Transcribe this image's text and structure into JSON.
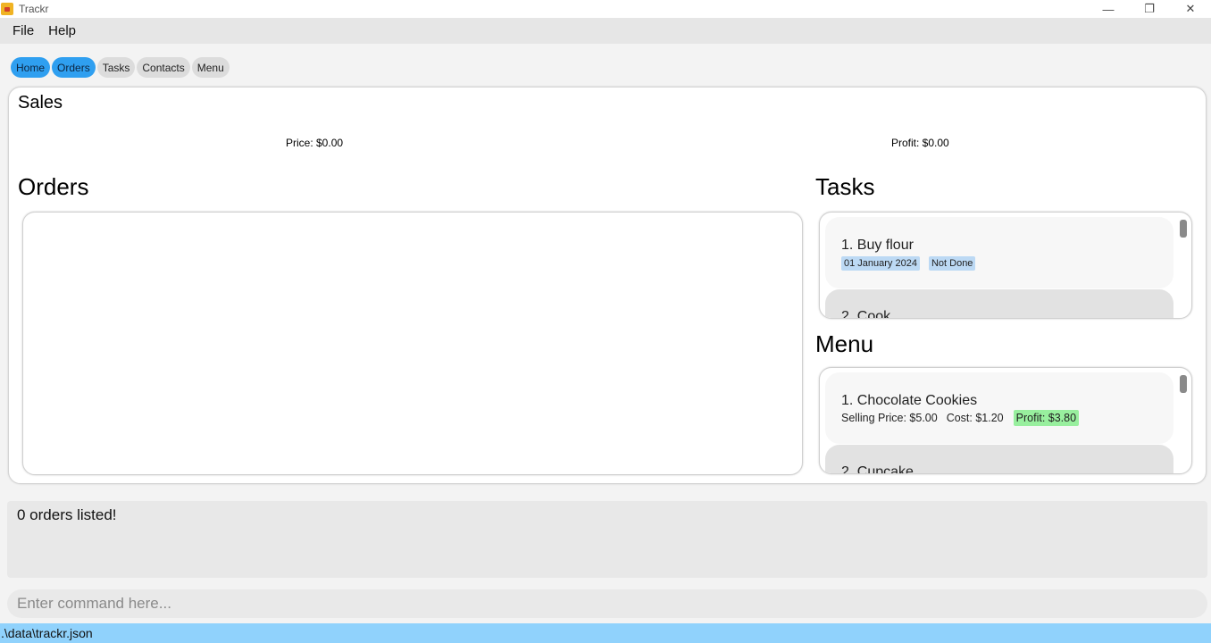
{
  "window": {
    "title": "Trackr",
    "controls": {
      "minimize": "—",
      "restore": "❐",
      "close": "✕"
    }
  },
  "menubar": {
    "items": [
      "File",
      "Help"
    ]
  },
  "tabs": [
    {
      "label": "Home",
      "active": true
    },
    {
      "label": "Orders",
      "active": true
    },
    {
      "label": "Tasks",
      "active": false
    },
    {
      "label": "Contacts",
      "active": false
    },
    {
      "label": "Menu",
      "active": false
    }
  ],
  "sales": {
    "title": "Sales",
    "price": "Price: $0.00",
    "profit": "Profit: $0.00"
  },
  "orders": {
    "title": "Orders"
  },
  "tasks": {
    "title": "Tasks",
    "items": [
      {
        "title": "1.  Buy flour",
        "date": "01 January 2024",
        "status": "Not Done"
      },
      {
        "title": "2.  Cook"
      }
    ]
  },
  "menu": {
    "title": "Menu",
    "items": [
      {
        "title": "1.  Chocolate Cookies",
        "selling_price": "Selling Price: $5.00",
        "cost": "Cost: $1.20",
        "profit": "Profit: $3.80"
      },
      {
        "title": "2.  Cupcake"
      }
    ]
  },
  "result": {
    "text": "0 orders listed!"
  },
  "command": {
    "placeholder": "Enter command here..."
  },
  "status": {
    "path": ".\\data\\trackr.json"
  },
  "colors": {
    "tab_active": "#2f9ff0",
    "tab_inactive": "#dcdcdc",
    "status_bar": "#90d2fc",
    "tag_blue": "#bcd9f4",
    "tag_green": "#98ef9e"
  }
}
